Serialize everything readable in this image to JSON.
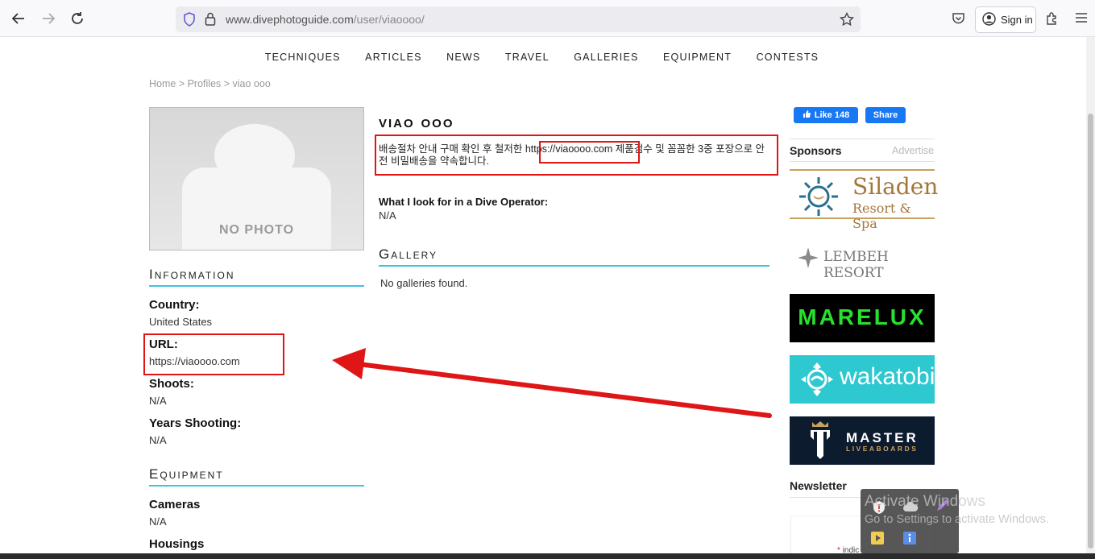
{
  "browser": {
    "url_host": "www.divephotoguide.com",
    "url_path": "/user/viaoooo/",
    "signin_label": "Sign in"
  },
  "site_nav": [
    "TECHNIQUES",
    "ARTICLES",
    "NEWS",
    "TRAVEL",
    "GALLERIES",
    "EQUIPMENT",
    "CONTESTS"
  ],
  "breadcrumb": "Home > Profiles > viao ooo",
  "profile": {
    "photo_label": "NO PHOTO",
    "name": "viao ooo",
    "bio_before": "배송절차 안내 구매 확인 후 철저한 ",
    "bio_link": "https://viaoooo.com",
    "bio_after": " 제품검수 및 꼼꼼한 3중 포장으로 안전 비밀배송을 약속합니다.",
    "dive_operator_label": "What I look for in a Dive Operator:",
    "dive_operator_value": "N/A"
  },
  "information": {
    "heading": "Information",
    "country_label": "Country:",
    "country_value": "United States",
    "url_label": "URL:",
    "url_value": "https://viaoooo.com",
    "shoots_label": "Shoots:",
    "shoots_value": "N/A",
    "years_label": "Years Shooting:",
    "years_value": "N/A"
  },
  "equipment": {
    "heading": "Equipment",
    "cameras_label": "Cameras",
    "cameras_value": "N/A",
    "housings_label": "Housings"
  },
  "gallery": {
    "heading": "Gallery",
    "empty_text": "No galleries found."
  },
  "sidebar": {
    "like_label": "Like 148",
    "share_label": "Share",
    "sponsors_label": "Sponsors",
    "advertise_label": "Advertise",
    "newsletter_label": "Newsletter",
    "newsletter_note": "indic",
    "ads": [
      {
        "name": "siladen",
        "line1": "Siladen",
        "line2": "Resort & Spa"
      },
      {
        "name": "lembeh",
        "line1": "LEMBEH RESORT"
      },
      {
        "name": "marelux",
        "line1": "MARELUX"
      },
      {
        "name": "wakatobi",
        "line1": "wakatobi"
      },
      {
        "name": "master",
        "line1": "MASTER",
        "line2": "LIVEABOARDS"
      }
    ]
  },
  "os_overlay": {
    "watermark_title": "Activate Windows",
    "watermark_sub": "Go to Settings to activate Windows."
  },
  "colors": {
    "accent_underline": "#3fc2e0",
    "annotation_red": "#e01515",
    "facebook_blue": "#1877f2"
  }
}
